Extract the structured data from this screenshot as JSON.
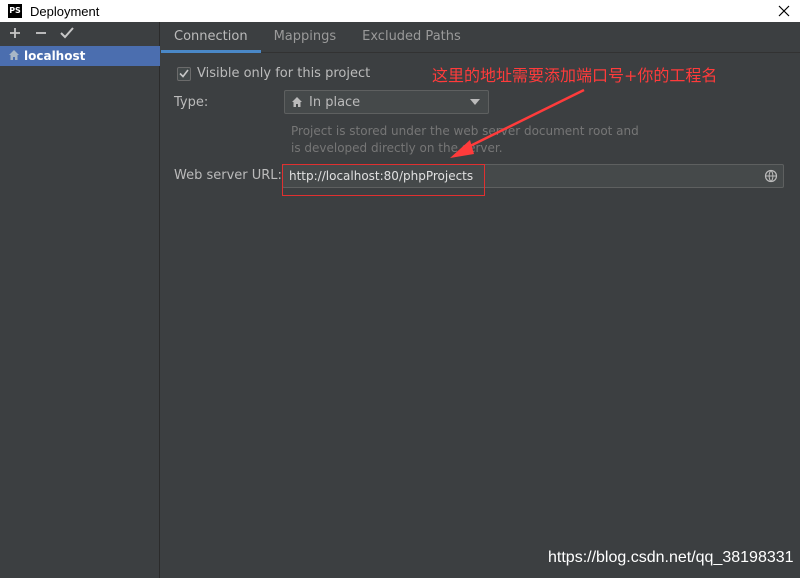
{
  "window": {
    "title": "Deployment",
    "logo_text": "PS"
  },
  "sidebar": {
    "toolbar": [
      {
        "name": "add-button",
        "glyph": "+"
      },
      {
        "name": "remove-button",
        "glyph": "−"
      },
      {
        "name": "apply-button",
        "glyph": "✔"
      }
    ],
    "server_label": "localhost"
  },
  "tabs": [
    "Connection",
    "Mappings",
    "Excluded Paths"
  ],
  "connection": {
    "visible_only_label": "Visible only for this project",
    "visible_only_checked": true,
    "type_label": "Type:",
    "type_value": "In place",
    "hint_line1": "Project is stored under the web server document root and",
    "hint_line2": "is developed directly on the server.",
    "url_label": "Web server URL:",
    "url_value": "http://localhost:80/phpProjects"
  },
  "annotation": {
    "text": "这里的地址需要添加端口号+你的工程名",
    "color": "#ff3b3b"
  },
  "watermark": "https://blog.csdn.net/qq_38198331",
  "colors": {
    "accent": "#4a88c7",
    "selection": "#4b6eaf",
    "background": "#3c3f41"
  }
}
